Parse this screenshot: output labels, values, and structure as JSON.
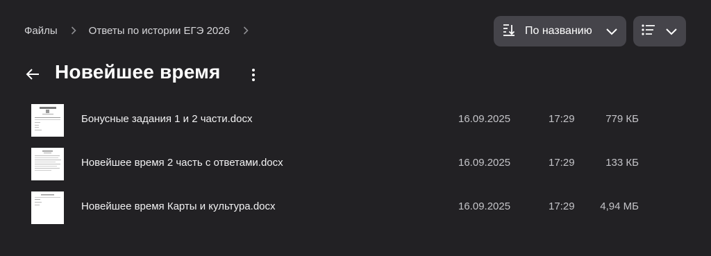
{
  "breadcrumb": {
    "items": [
      {
        "label": "Файлы"
      },
      {
        "label": "Ответы по истории ЕГЭ 2026"
      }
    ]
  },
  "sort": {
    "label": "По названию",
    "icon": "sort-descending-icon"
  },
  "view": {
    "icon": "list-view-icon"
  },
  "header": {
    "title": "Новейшее время"
  },
  "files": [
    {
      "name": "Бонусные задания 1 и 2 части.docx",
      "date": "16.09.2025",
      "time": "17:29",
      "size": "779 КБ"
    },
    {
      "name": "Новейшее время 2 часть с ответами.docx",
      "date": "16.09.2025",
      "time": "17:29",
      "size": "133 КБ"
    },
    {
      "name": "Новейшее время Карты и культура.docx",
      "date": "16.09.2025",
      "time": "17:29",
      "size": "4,94 МБ"
    }
  ],
  "colors": {
    "background": "#222124",
    "button_bg": "#45444a",
    "text": "#ffffff",
    "muted_text": "#c4c4c8"
  }
}
